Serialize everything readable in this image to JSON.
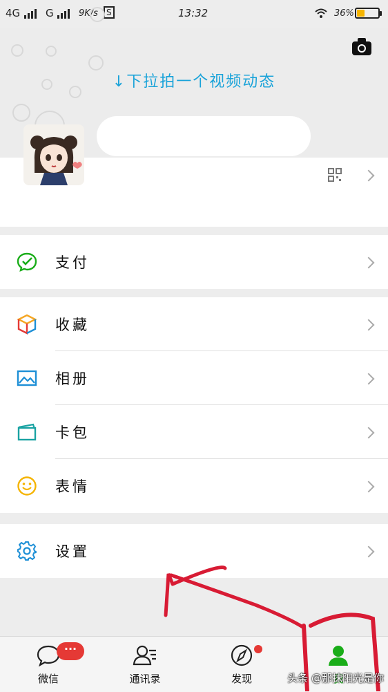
{
  "status_bar": {
    "network1": "4G",
    "network2": "G",
    "speed": "9K/s",
    "sim_icon": "S",
    "time": "13:32",
    "battery": "36%",
    "battery_level": 0.36,
    "icons": [
      "signal-icon",
      "wifi-icon",
      "battery-icon"
    ]
  },
  "header": {
    "camera_icon": "camera-icon",
    "pull_hint": "↓下拉拍一个视频动态"
  },
  "profile": {
    "qr_icon": "qr-code-icon"
  },
  "menu": {
    "groups": [
      [
        {
          "label": "支付",
          "icon": "pay-icon",
          "color": "#1aad19"
        }
      ],
      [
        {
          "label": "收藏",
          "icon": "favorites-icon",
          "color": "#f5a623"
        },
        {
          "label": "相册",
          "icon": "album-icon",
          "color": "#1d8fd6"
        },
        {
          "label": "卡包",
          "icon": "card-icon",
          "color": "#1aa3a3"
        },
        {
          "label": "表情",
          "icon": "emoji-icon",
          "color": "#f5b400"
        }
      ],
      [
        {
          "label": "设置",
          "icon": "settings-icon",
          "color": "#1d8fd6"
        }
      ]
    ]
  },
  "tabbar": {
    "tabs": [
      {
        "label": "微信",
        "icon": "chat-icon",
        "badge": "···"
      },
      {
        "label": "通讯录",
        "icon": "contacts-icon"
      },
      {
        "label": "发现",
        "icon": "compass-icon"
      },
      {
        "label": "我",
        "icon": "me-icon",
        "active": true
      }
    ],
    "active_color": "#1aad19"
  },
  "watermark": "头条 @那抹阳光是你"
}
